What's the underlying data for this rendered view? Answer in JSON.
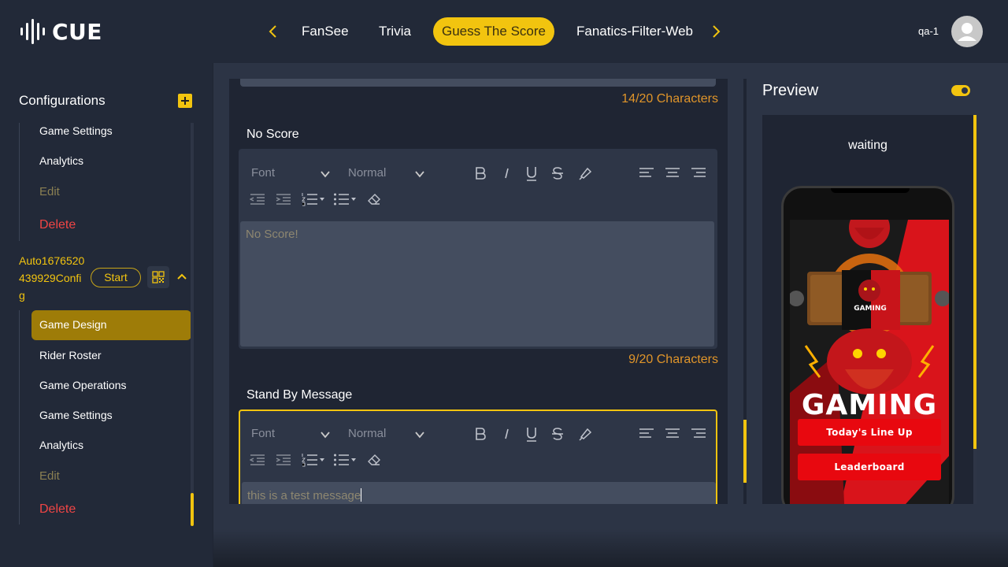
{
  "header": {
    "logo_text": "CUE",
    "tabs": [
      {
        "label": "FanSee"
      },
      {
        "label": "Trivia"
      },
      {
        "label": "Guess The Score"
      },
      {
        "label": "Fanatics-Filter-Web"
      }
    ],
    "active_tab": "Guess The Score",
    "user_name": "qa-1"
  },
  "sidebar": {
    "title": "Configurations",
    "first_group": {
      "items": [
        "Game Settings",
        "Analytics",
        "Edit",
        "Delete"
      ]
    },
    "config": {
      "name": "Auto1676520439929Config",
      "start_label": "Start"
    },
    "second_group": {
      "active": "Game Design",
      "items": [
        "Rider Roster",
        "Game Operations",
        "Game Settings",
        "Analytics",
        "Edit",
        "Delete"
      ]
    }
  },
  "editor": {
    "top_counter": "14/20 Characters",
    "no_score": {
      "label": "No Score",
      "font_placeholder": "Font",
      "size_value": "Normal",
      "content": "No Score!",
      "counter": "9/20 Characters"
    },
    "stand_by": {
      "label": "Stand By Message",
      "font_placeholder": "Font",
      "size_value": "Normal",
      "content": "this is a test message"
    }
  },
  "preview": {
    "title": "Preview",
    "status": "waiting",
    "phone": {
      "logo_badge": "GAMING",
      "headline": "GAMING",
      "button_1": "Today's Line Up",
      "button_2": "Leaderboard"
    }
  },
  "colors": {
    "accent": "#f2c40f",
    "danger": "#f04545",
    "counter": "#e0952a",
    "background": "#1f2533",
    "panel": "#2c3445"
  }
}
